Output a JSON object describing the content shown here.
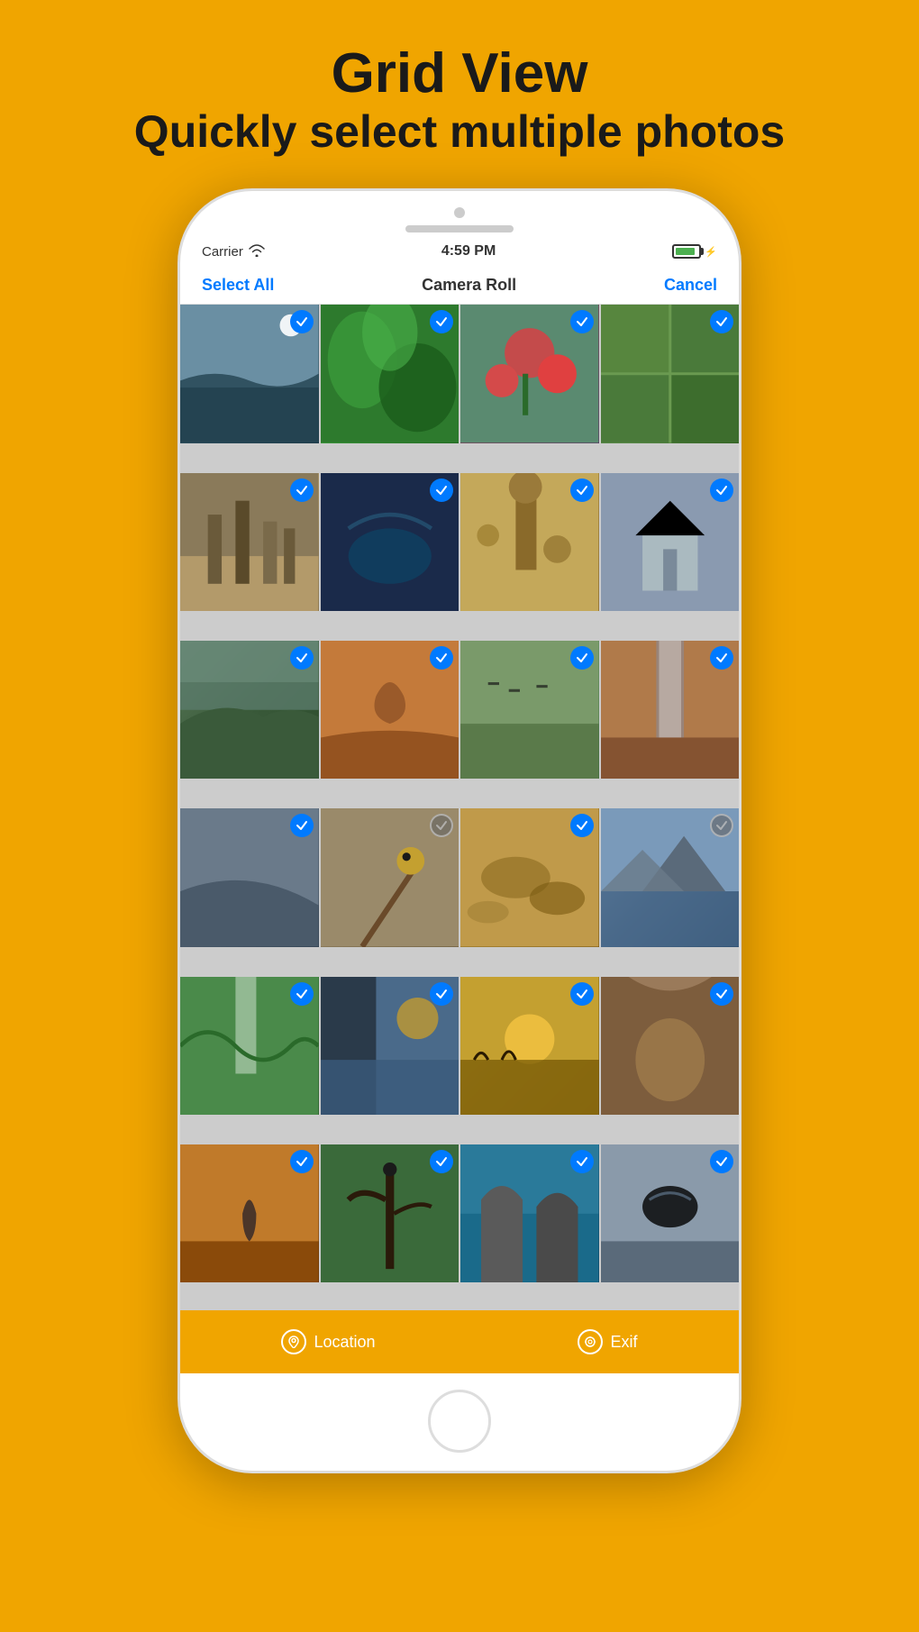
{
  "page": {
    "title": "Grid View",
    "subtitle_normal": "Quickly select ",
    "subtitle_bold": "multiple photos",
    "background_color": "#F0A500"
  },
  "status_bar": {
    "carrier": "Carrier",
    "time": "4:59 PM"
  },
  "nav_bar": {
    "select_all": "Select All",
    "title": "Camera Roll",
    "cancel": "Cancel"
  },
  "toolbar": {
    "location_label": "Location",
    "exif_label": "Exif"
  },
  "photos": [
    {
      "id": 1,
      "selected": true,
      "class": "photo-1"
    },
    {
      "id": 2,
      "selected": true,
      "class": "photo-2"
    },
    {
      "id": 3,
      "selected": true,
      "class": "photo-3"
    },
    {
      "id": 4,
      "selected": true,
      "class": "photo-4"
    },
    {
      "id": 5,
      "selected": true,
      "class": "photo-5"
    },
    {
      "id": 6,
      "selected": true,
      "class": "photo-6"
    },
    {
      "id": 7,
      "selected": true,
      "class": "photo-7"
    },
    {
      "id": 8,
      "selected": true,
      "class": "photo-8"
    },
    {
      "id": 9,
      "selected": true,
      "class": "photo-9"
    },
    {
      "id": 10,
      "selected": true,
      "class": "photo-10"
    },
    {
      "id": 11,
      "selected": true,
      "class": "photo-11"
    },
    {
      "id": 12,
      "selected": true,
      "class": "photo-12"
    },
    {
      "id": 13,
      "selected": true,
      "class": "photo-13"
    },
    {
      "id": 14,
      "selected": false,
      "class": "photo-14"
    },
    {
      "id": 15,
      "selected": true,
      "class": "photo-15"
    },
    {
      "id": 16,
      "selected": false,
      "class": "photo-16"
    },
    {
      "id": 17,
      "selected": true,
      "class": "photo-17"
    },
    {
      "id": 18,
      "selected": true,
      "class": "photo-18"
    },
    {
      "id": 19,
      "selected": true,
      "class": "photo-19"
    },
    {
      "id": 20,
      "selected": true,
      "class": "photo-20"
    },
    {
      "id": 21,
      "selected": true,
      "class": "photo-21"
    },
    {
      "id": 22,
      "selected": true,
      "class": "photo-22"
    },
    {
      "id": 23,
      "selected": true,
      "class": "photo-23"
    },
    {
      "id": 24,
      "selected": true,
      "class": "photo-24"
    }
  ]
}
